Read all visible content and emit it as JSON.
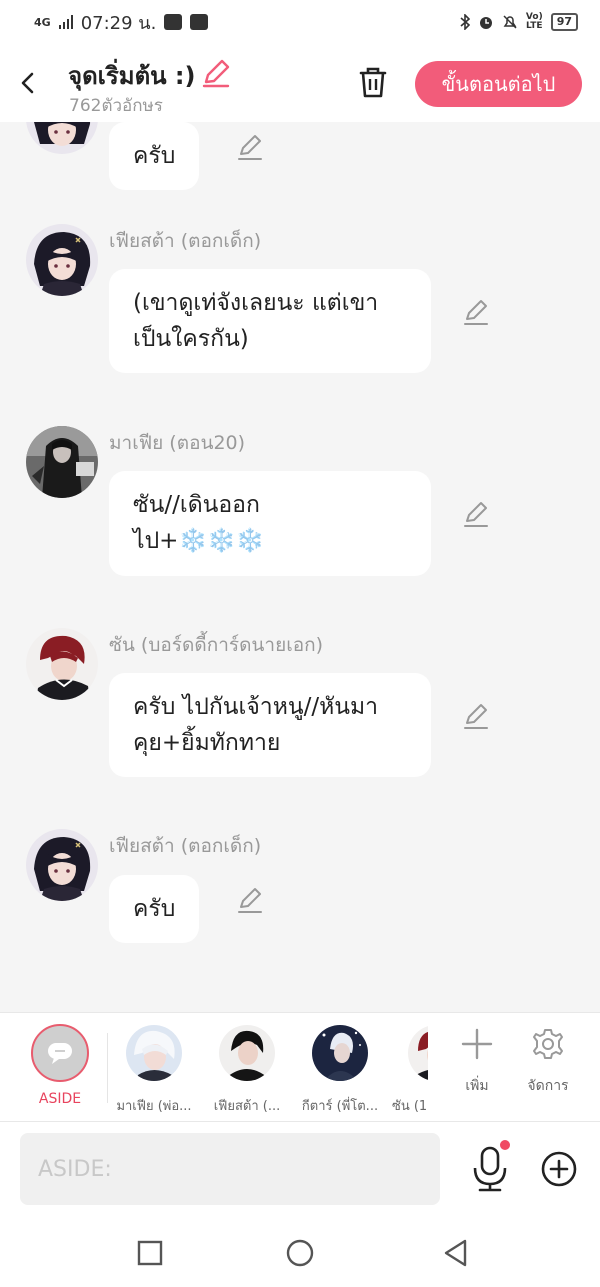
{
  "status": {
    "network": "4G",
    "time": "07:29 น.",
    "battery": "97",
    "lte_top": "Vo)",
    "lte_bottom": "LTE"
  },
  "header": {
    "title": "จุดเริ่มต้น :)",
    "char_count": "762ตัวอักษร",
    "next_label": "ขั้นตอนต่อไป"
  },
  "messages": [
    {
      "sender": "",
      "text": "ครับ",
      "avatar": "fia"
    },
    {
      "sender": "เฟียสต้า (ตอกเด็ก)",
      "text": "(เขาดูเท่จังเลยนะ แต่เขาเป็นใครกัน)",
      "avatar": "fia"
    },
    {
      "sender": "มาเฟีย (ตอน20)",
      "text": "ซัน//เดินออกไป+❄️❄️❄️",
      "avatar": "mafia"
    },
    {
      "sender": "ซัน (บอร์ดดี้การ์ดนายเอก)",
      "text": "ครับ ไปกันเจ้าหนู//หันมาคุย+ยิ้มทักทาย",
      "avatar": "sun"
    },
    {
      "sender": "เฟียสต้า (ตอกเด็ก)",
      "text": "ครับ",
      "avatar": "fia"
    }
  ],
  "character_bar": {
    "aside_label": "ASIDE",
    "characters": [
      {
        "name": "มาเฟีย (พ่อ...",
        "avatar": "white-hair"
      },
      {
        "name": "เฟียสต้า (...",
        "avatar": "dark-hair"
      },
      {
        "name": "กีตาร์ (พี่โต...",
        "avatar": "night"
      },
      {
        "name": "ซัน (1",
        "avatar": "sun"
      }
    ],
    "add_label": "เพิ่ม",
    "manage_label": "จัดการ"
  },
  "input": {
    "placeholder": "ASIDE:"
  },
  "colors": {
    "accent": "#f25c7a",
    "aside_red": "#e8445e"
  }
}
